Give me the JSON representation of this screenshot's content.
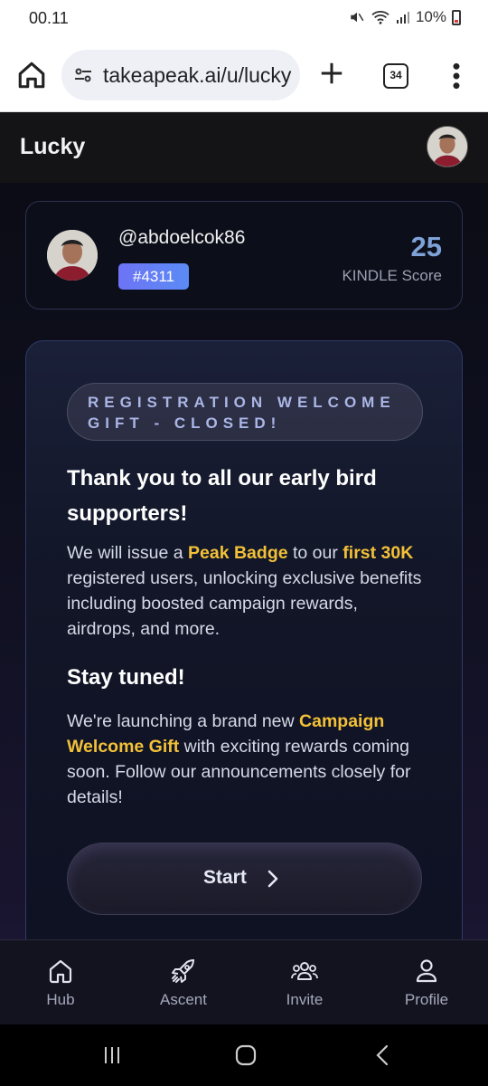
{
  "status_bar": {
    "time": "00.11",
    "battery": "10%"
  },
  "browser": {
    "url": "takeapeak.ai/u/lucky",
    "tab_count": "34"
  },
  "header": {
    "title": "Lucky"
  },
  "profile": {
    "username": "@abdoelcok86",
    "rank": "#4311",
    "score": "25",
    "score_label": "KINDLE Score"
  },
  "welcome": {
    "pill": "REGISTRATION WELCOME GIFT - CLOSED!",
    "heading": "Thank you to all our early bird supporters!",
    "p1": {
      "a": "We will issue a ",
      "b": "Peak Badge",
      "c": " to our ",
      "d": "first 30K",
      "e": " registered users, unlocking exclusive benefits including boosted campaign rewards, airdrops, and more."
    },
    "heading2": "Stay tuned!",
    "p2": {
      "a": "We're launching a brand new ",
      "b": "Campaign Welcome Gift",
      "c": " with exciting rewards coming soon. Follow our announcements closely for details!"
    },
    "start_label": "Start"
  },
  "nav": {
    "hub": "Hub",
    "ascent": "Ascent",
    "invite": "Invite",
    "profile": "Profile"
  },
  "colors": {
    "accent_yellow": "#f3c138",
    "score_blue": "#7ea2d8",
    "badge_gradient_start": "#6d74f5",
    "badge_gradient_end": "#5b8bf5"
  }
}
